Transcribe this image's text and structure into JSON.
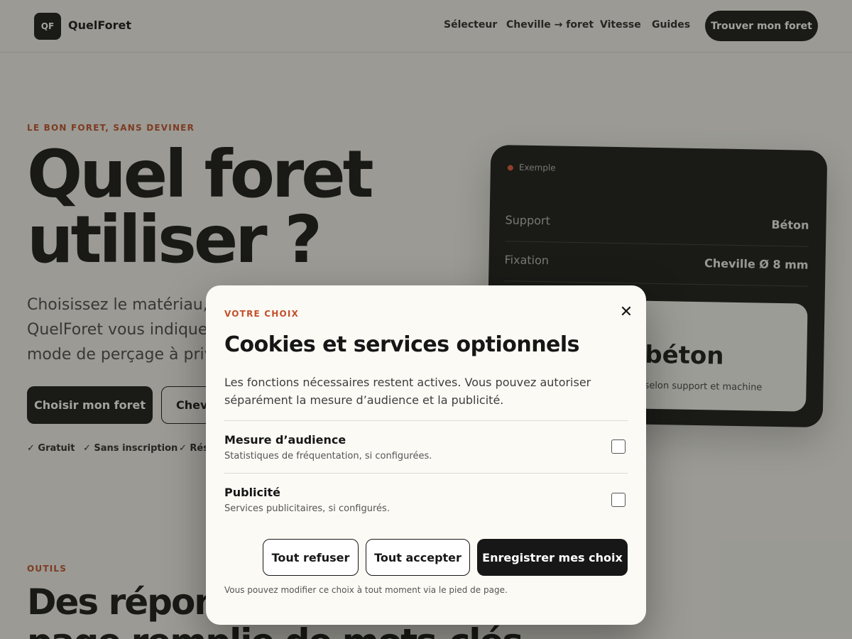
{
  "header": {
    "logo_mark": "QF",
    "brand": "QuelForet",
    "nav": [
      "Sélecteur",
      "Cheville → foret",
      "Vitesse",
      "Guides"
    ],
    "cta": "Trouver mon foret"
  },
  "hero": {
    "eyebrow": "LE BON FORET, SANS DEVINER",
    "title_line1": "Quel foret",
    "title_line2": "utiliser ?",
    "text_lines": [
      "Choisissez le matériau, v",
      "QuelForet vous indique l",
      "mode de perçage à privil"
    ],
    "primary_button": "Choisir mon foret",
    "secondary_button": "Chevi",
    "perks": [
      "✓ Gratuit",
      "✓ Sans inscription",
      "✓ Résu"
    ]
  },
  "example_card": {
    "tag": "Exemple",
    "rows": [
      {
        "key": "Support",
        "value": "Béton"
      },
      {
        "key": "Fixation",
        "value": "Cheville Ø 8 mm"
      }
    ],
    "result_big": "béton",
    "result_sub": "selon support et machine"
  },
  "tools_section": {
    "eyebrow": "OUTILS",
    "title_line1": "Des répons",
    "title_line2": "page remplie de mots-clés"
  },
  "cookie_modal": {
    "eyebrow": "VOTRE CHOIX",
    "close_glyph": "✕",
    "title": "Cookies et services optionnels",
    "description": "Les fonctions nécessaires restent actives. Vous pouvez autoriser séparément la mesure d’audience et la publicité.",
    "options": [
      {
        "label": "Mesure d’audience",
        "description": "Statistiques de fréquentation, si configurées.",
        "checked": false
      },
      {
        "label": "Publicité",
        "description": "Services publicitaires, si configurés.",
        "checked": false
      }
    ],
    "buttons": {
      "refuse": "Tout refuser",
      "accept": "Tout accepter",
      "save": "Enregistrer mes choix"
    },
    "footnote": "Vous pouvez modifier ce choix à tout moment via le pied de page."
  },
  "colors": {
    "accent": "#c2502b",
    "dark": "#171717",
    "background": "#f4f3ee",
    "modal_background": "#fbfaf5"
  }
}
